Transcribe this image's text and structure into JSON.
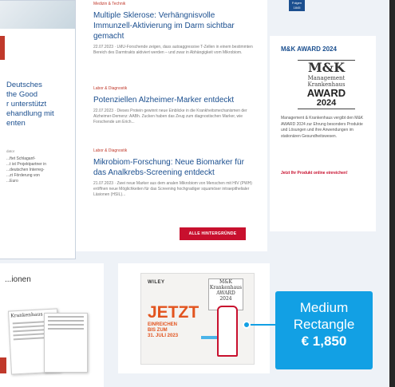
{
  "left_feature": {
    "headline": "Deutsches ...the Good ... unterstützt ...handlung mit ...enten",
    "headline_lines": [
      "Deutsches",
      "the Good",
      "r unterstützt",
      "ehandlung mit",
      "enten"
    ],
    "small_date": "dator",
    "body_lines": [
      "...ftet Schlaganf-",
      "...t ist Projektpartner in",
      "...deutschen Interreg-",
      "...zt Förderung von",
      "...Euro"
    ]
  },
  "articles": [
    {
      "category": "Medizin & Technik",
      "title": "Multiple Sklerose: Verhängnisvolle Immunzell-Aktivierung im Darm sichtbar gemacht",
      "meta": "22.07.2023 · LMU-Forschende zeigen, dass autoaggressive T-Zellen in einem bestimmten Bereich des Darmtrakts aktiviert werden – und zwar in Abhängigkeit vom Mikrobiom."
    },
    {
      "category": "Labor & Diagnostik",
      "title": "Potenziellen Alzheimer-Marker entdeckt",
      "meta": "22.07.2023 · Dieses Protein gewinnt neue Einblicke in die Krankheitsmechanismen der Alzheimer-Demenz: AABh. Zucken haben das Zeug zum diagnostischen Marker, wie Forschende um Erich..."
    },
    {
      "category": "Labor & Diagnostik",
      "title": "Mikrobiom-Forschung: Neue Biomarker für das Analkrebs-Screening entdeckt",
      "meta": "21.07.2023 · Zwei neue Marker aus dem analen Mikrobiom von Menschen mit HIV (PWH) eröffnen neue Möglichkeiten für das Screening hochgradiger squamöser intraepithelialer Läsionen (HSIL)..."
    }
  ],
  "more_button": "ALLE HINTERGRÜNDE",
  "social": {
    "label": "Folgen",
    "count": "1845"
  },
  "award": {
    "heading": "M&K AWARD 2024",
    "logo_brand": "M&K",
    "logo_sub1": "Management",
    "logo_sub2": "Krankenhaus",
    "logo_award": "AWARD",
    "logo_year": "2024",
    "description": "Management & Krankenhaus vergibt den M&K AWARD 2024 zur Ehrung besonders Produkte und Lösungen und ihre Anwendungen im stationären Gesundheitswesen.",
    "link": "Jetzt Ihr Produkt online einreichen!"
  },
  "bottom_left": {
    "title": "...ionen",
    "mag_title": "Krankenhaus"
  },
  "ad": {
    "publisher": "WILEY",
    "mini_logo_lines": [
      "M&K",
      "Krankenhaus",
      "AWARD",
      "2024"
    ],
    "headline": "JETZT",
    "subline1": "EINREICHEN",
    "subline2": "BIS ZUM",
    "subline3": "31. JULI 2023"
  },
  "callout": {
    "label_line1": "Medium",
    "label_line2": "Rectangle",
    "price": "€ 1,850"
  },
  "colors": {
    "accent_blue": "#1b4f8f",
    "callout_blue": "#12a0e4",
    "brand_red": "#c8102e"
  }
}
